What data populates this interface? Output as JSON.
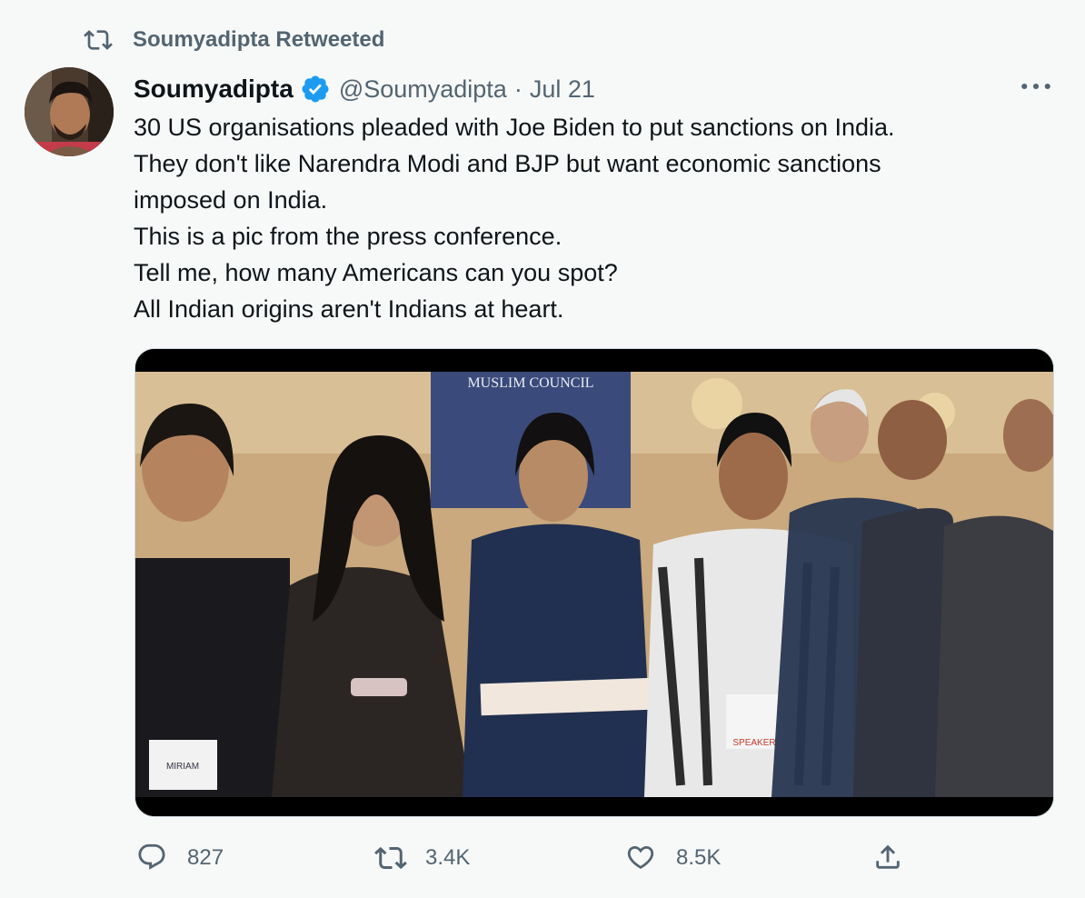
{
  "retweet_context": {
    "text": "Soumyadipta Retweeted",
    "icon": "retweet-icon"
  },
  "author": {
    "name": "Soumyadipta",
    "handle": "@Soumyadipta",
    "separator": "·",
    "date": "Jul 21",
    "verified_icon": "verified-badge-icon"
  },
  "tweet": {
    "lines": [
      "30 US organisations pleaded with Joe Biden to put sanctions on India.",
      "They don't like Narendra Modi and BJP but want economic sanctions",
      "imposed on India.",
      "This is a pic from the press conference.",
      "Tell me, how many Americans can you spot?",
      "All Indian origins aren't Indians at heart."
    ]
  },
  "media": {
    "banner_text": "MUSLIM COUNCIL",
    "badges": [
      "MIRIAM",
      "SPEAKER"
    ]
  },
  "actions": {
    "reply": {
      "count": "827",
      "icon": "reply-icon"
    },
    "retweet": {
      "count": "3.4K",
      "icon": "retweet-icon"
    },
    "like": {
      "count": "8.5K",
      "icon": "heart-icon"
    },
    "share": {
      "icon": "share-icon"
    }
  },
  "colors": {
    "background": "#f7f9f9",
    "text_primary": "#0f1419",
    "text_secondary": "#536471",
    "verified_blue": "#1d9bf0"
  }
}
